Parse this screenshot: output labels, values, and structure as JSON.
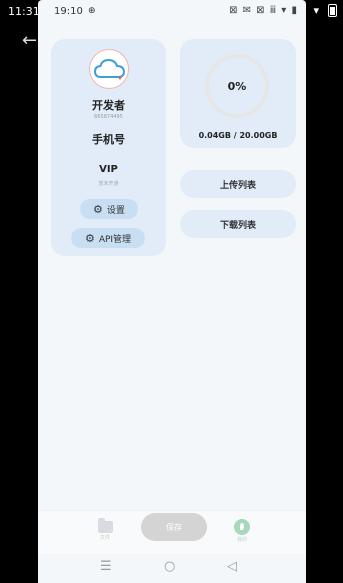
{
  "outer_status": {
    "time": "11:31",
    "wifi_icon": "wifi-icon",
    "battery_icon": "battery-icon"
  },
  "inner_status": {
    "time": "19:10",
    "dot": "⊕",
    "icons": "⊠ ✉ ⊠ ⅲ ▾ ▮"
  },
  "back_icon": "back-arrow-icon",
  "profile": {
    "name": "开发者",
    "id": "665874495",
    "phone": "手机号",
    "vip": "VIP",
    "vip_status": "暂未开通",
    "settings_label": "设置",
    "api_label": "API管理"
  },
  "storage": {
    "percent_label": "0%",
    "percent_value": 0.2,
    "usage": "0.04GB / 20.00GB"
  },
  "actions": {
    "upload": "上传列表",
    "download": "下载列表"
  },
  "bottom_nav": {
    "files_label": "文件",
    "save_label": "保存",
    "mine_label": "我的"
  },
  "colors": {
    "card_bg": "#e1ecf8",
    "chip_bg": "#c8dff3",
    "accent_green": "#a8d7bc"
  }
}
